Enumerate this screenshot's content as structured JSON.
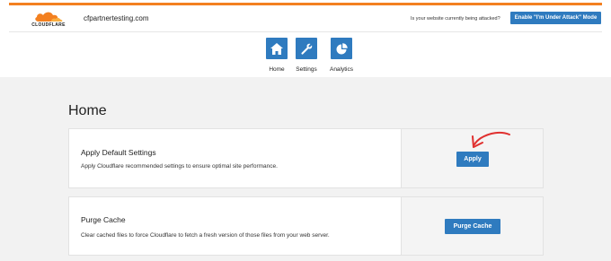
{
  "colors": {
    "accent_stripe": "#f38020",
    "primary_button": "#2f7bbf",
    "page_background": "#f2f2f2",
    "annotation_arrow": "#e0302f"
  },
  "header": {
    "logo_text": "CLOUDFLARE",
    "domain": "cfpartnertesting.com",
    "attack_question": "Is your website currently being attacked?",
    "attack_button_label": "Enable \"I'm Under Attack\" Mode"
  },
  "nav": {
    "items": [
      {
        "label": "Home",
        "icon": "home-icon"
      },
      {
        "label": "Settings",
        "icon": "wrench-icon"
      },
      {
        "label": "Analytics",
        "icon": "pie-chart-icon"
      }
    ]
  },
  "main": {
    "title": "Home",
    "cards": [
      {
        "title": "Apply Default Settings",
        "description": "Apply Cloudflare recommended settings to ensure optimal site performance.",
        "button_label": "Apply"
      },
      {
        "title": "Purge Cache",
        "description": "Clear cached files to force Cloudflare to fetch a fresh version of those files from your web server.",
        "button_label": "Purge Cache"
      }
    ]
  }
}
